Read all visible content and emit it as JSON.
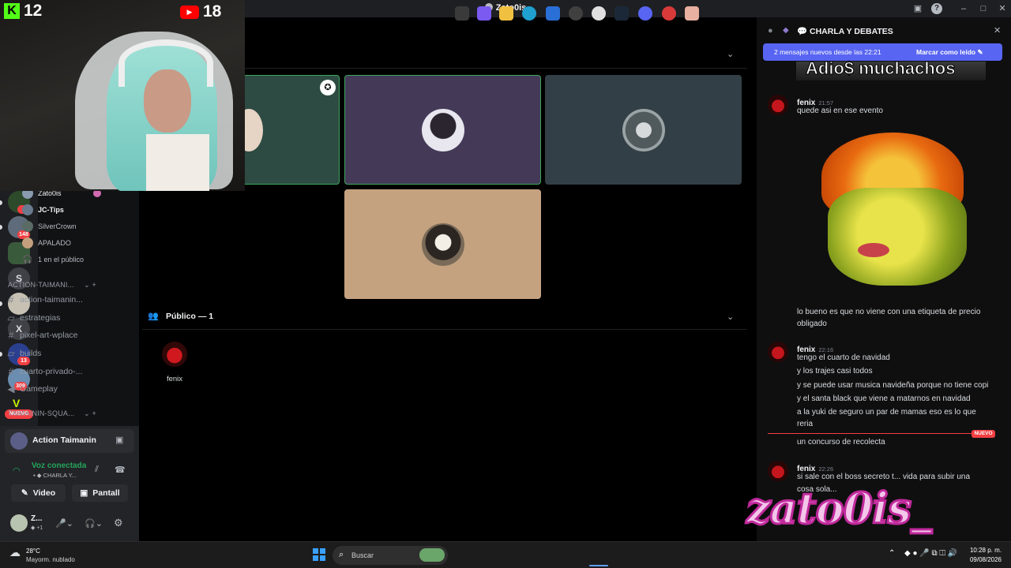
{
  "window": {
    "title": "Zato0is"
  },
  "stream_overlay": {
    "kick_count": "12",
    "youtube_count": "18",
    "watermark_text": "zato0is_"
  },
  "rail": {
    "servers": [
      {
        "badge": "4"
      },
      {
        "badge": "148"
      },
      {
        "badge": ""
      },
      {
        "letter": "S",
        "badge": ""
      },
      {
        "badge": ""
      },
      {
        "letter": "X",
        "badge": ""
      },
      {
        "badge": "13"
      },
      {
        "badge": "309"
      }
    ],
    "new_label": "NUEVO"
  },
  "sidebar": {
    "voice_users": [
      "Zato0is",
      "JC-Tips",
      "SilverCrown",
      "APALADO"
    ],
    "audience_label": "1 en el público",
    "category1": "ACTION-TAIMANI...",
    "channels": [
      {
        "name": "action-taimanin...",
        "icon": "hash-icon"
      },
      {
        "name": "estrategias",
        "icon": "forum-icon"
      },
      {
        "name": "pixel-art-wplace",
        "icon": "hash-icon"
      },
      {
        "name": "builds",
        "icon": "forum-icon"
      },
      {
        "name": "cuarto-privado-...",
        "icon": "hash-icon"
      },
      {
        "name": "Gameplay",
        "icon": "speaker-icon"
      }
    ],
    "category2": "TAIMAININ-SQUA..."
  },
  "voice_panel": {
    "server_name": "Action Taimanin",
    "status": "Voz conectada",
    "channel": "CHARLA Y...",
    "video_label": "Video",
    "screen_label": "Pantall",
    "user_short": "Z...",
    "user_sub": "+1"
  },
  "stage": {
    "audience_header": "Público — 1",
    "audience_member": "fenix"
  },
  "chat": {
    "channel_title": "CHARLA Y DEBATES",
    "banner_text": "2 mensajes nuevos desde las 22:21",
    "mark_read": "Marcar como leído",
    "gif_caption": "Adio$ muchachos",
    "messages": [
      {
        "author": "fenix",
        "time": "21:57",
        "lines": [
          "quede asi en ese evento"
        ]
      },
      {
        "lines": [
          "lo bueno es que no viene con una etiqueta de precio",
          "obligado"
        ]
      },
      {
        "author": "fenix",
        "time": "22:16",
        "lines": [
          "tengo el cuarto de navidad",
          "y los trajes casi todos",
          "y se puede usar musica navideña porque no tiene copi",
          "y el santa black que viene a matarnos en navidad",
          "a la yuki de seguro un par de mamas eso es lo que",
          "reria"
        ]
      },
      {
        "new_divider": "NUEVO",
        "lines": [
          "un concurso de recolecta"
        ]
      },
      {
        "author": "fenix",
        "time": "22:26",
        "lines": [
          "si sale con el boss secreto t... vida para subir una",
          "cosa sola..."
        ]
      }
    ]
  },
  "taskbar": {
    "weather_temp": "28°C",
    "weather_desc": "Mayorm. nublado",
    "search_placeholder": "Buscar",
    "time": "10:28 p. m.",
    "date": "09/08/2026"
  }
}
